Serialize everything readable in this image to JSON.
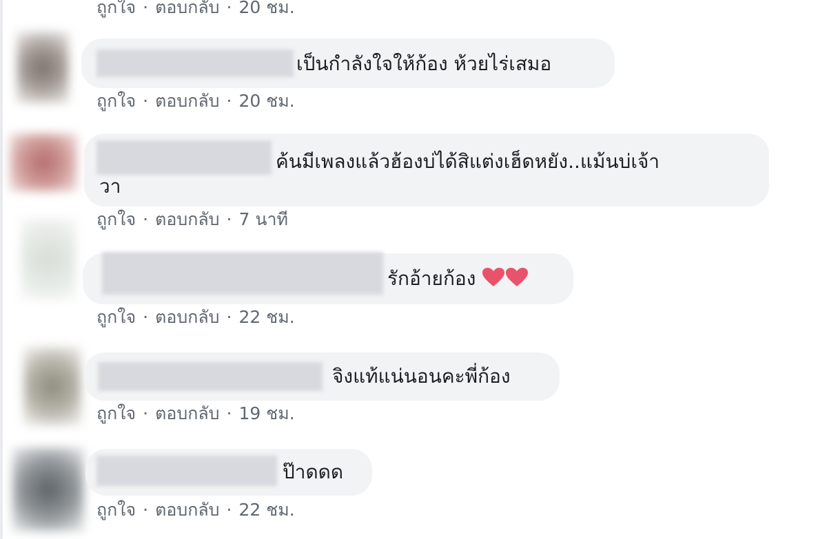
{
  "comments": [
    {
      "text": "",
      "like_label": "ถูกใจ",
      "reply_label": "ตอบกลับ",
      "time": "20 ชม."
    },
    {
      "text": "เป็นกำลังใจให้ก้อง ห้วยไร่เสมอ",
      "like_label": "ถูกใจ",
      "reply_label": "ตอบกลับ",
      "time": "20 ชม."
    },
    {
      "text_line1": "ค้นมีเพลงแล้วฮ้องบ่ได้สิแต่งเฮ็ดหยัง..แม้นบ่เจ้า",
      "text_line2": "วา",
      "like_label": "ถูกใจ",
      "reply_label": "ตอบกลับ",
      "time": "7 นาที"
    },
    {
      "text": "รักอ้ายก้อง",
      "emoji": "heart-emoji ×2",
      "like_label": "ถูกใจ",
      "reply_label": "ตอบกลับ",
      "time": "22 ชม."
    },
    {
      "text": "จิงแท้แน่นอนคะพี่ก้อง",
      "like_label": "ถูกใจ",
      "reply_label": "ตอบกลับ",
      "time": "19 ชม."
    },
    {
      "text": "ป๊าดดด",
      "like_label": "ถูกใจ",
      "reply_label": "ตอบกลับ",
      "time": "22 ชม."
    }
  ],
  "separator": "·",
  "colors": {
    "bubble": "#f2f3f5",
    "action_text": "#606770",
    "comment_text": "#1c1e21",
    "heart": "#e8536b"
  }
}
